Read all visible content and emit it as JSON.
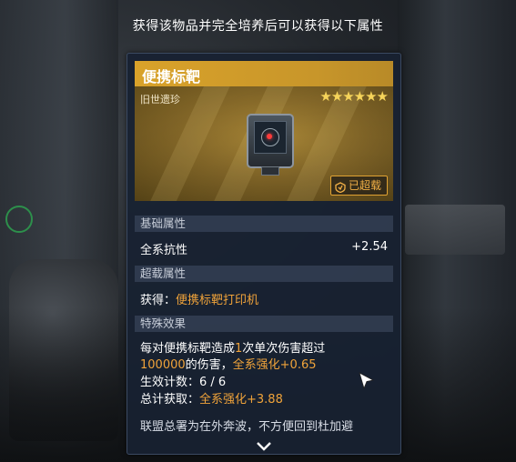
{
  "top_caption": "获得该物品并完全培养后可以获得以下属性",
  "item": {
    "name": "便携标靶",
    "subtitle": "旧世遗珍",
    "stars": "★★★★★★",
    "rating_value": 6,
    "rating_max": 6,
    "badge_label": "已超载"
  },
  "sections": {
    "base": {
      "title": "基础属性",
      "stat_label": "全系抗性",
      "stat_value": "+2.54"
    },
    "overload": {
      "title": "超载属性",
      "obtain_prefix": "获得：",
      "obtain_item": "便携标靶打印机"
    },
    "special": {
      "title": "特殊效果",
      "line1_a": "每对便携标靶造成",
      "line1_num": "1",
      "line1_b": "次单次伤害超过",
      "line2_num": "100000",
      "line2_b": "的伤害，",
      "line2_effect": "全系强化+0.65",
      "count_label": "生效计数：",
      "count_value": "6 / 6",
      "total_label": "总计获取：",
      "total_effect": "全系强化+3.88"
    },
    "flavor": "联盟总署为在外奔波，不方便回到杜加避"
  },
  "colors": {
    "accent_gold": "#d9a22a",
    "highlight_orange": "#f0a33a",
    "panel_bg": "#182132"
  }
}
